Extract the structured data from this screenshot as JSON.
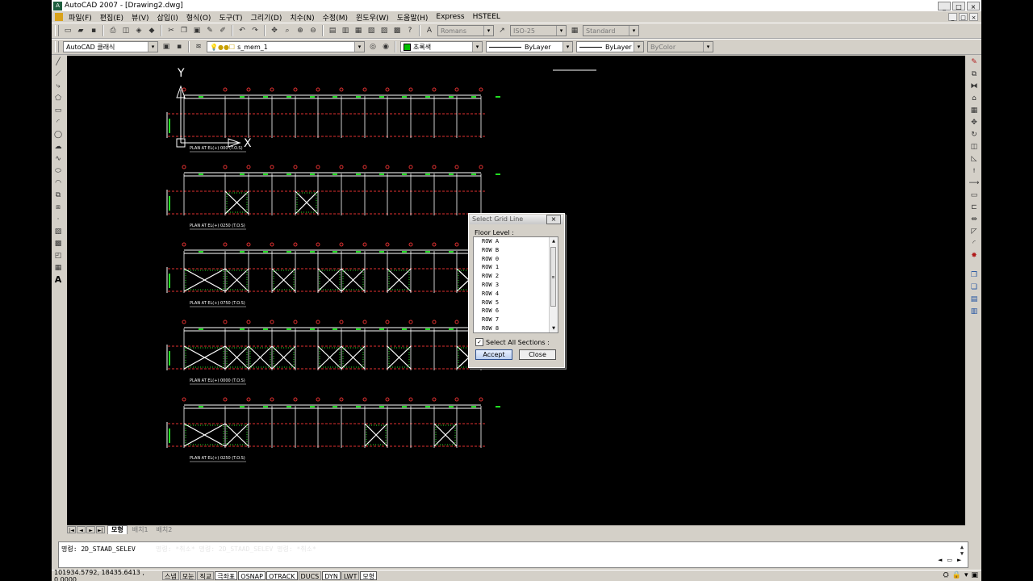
{
  "window": {
    "title": "AutoCAD 2007 - [Drawing2.dwg]",
    "app_icon": "A",
    "minimize": "_",
    "maximize": "□",
    "close": "×"
  },
  "menu": {
    "items": [
      "파일(F)",
      "편집(E)",
      "뷰(V)",
      "삽입(I)",
      "형식(O)",
      "도구(T)",
      "그리기(D)",
      "치수(N)",
      "수정(M)",
      "윈도우(W)",
      "도움말(H)",
      "Express",
      "HSTEEL"
    ]
  },
  "toolbar1": {
    "text_style": "Romans",
    "dim_style": "ISO-25",
    "table_style": "Standard"
  },
  "toolbar2": {
    "workspace": "AutoCAD 클래식",
    "layer": "s_mem_1",
    "color": "초록색",
    "linetype": "ByLayer",
    "lineweight": "ByLayer",
    "plotstyle": "ByColor"
  },
  "tabs": {
    "nav": [
      "|◄",
      "◄",
      "►",
      "►|"
    ],
    "model": "모형",
    "layout1": "배치1",
    "layout2": "배치2"
  },
  "command": {
    "prompt": "명령: 2D_STAAD_SELEV",
    "history_ghost": "명령:  *취소*     명령:  2D_STAAD_SELEV     명령:  *취소*"
  },
  "status": {
    "coords": "101934.5792, 18435.6413 , 0.0000",
    "buttons": [
      {
        "label": "스냅",
        "on": false
      },
      {
        "label": "모눈",
        "on": false
      },
      {
        "label": "직교",
        "on": false
      },
      {
        "label": "극좌표",
        "on": true
      },
      {
        "label": "OSNAP",
        "on": true
      },
      {
        "label": "OTRACK",
        "on": true
      },
      {
        "label": "DUCS",
        "on": false
      },
      {
        "label": "DYN",
        "on": true
      },
      {
        "label": "LWT",
        "on": false
      },
      {
        "label": "모형",
        "on": true
      }
    ]
  },
  "drawing": {
    "ucs_y": "Y",
    "ucs_x": "X",
    "plans": [
      {
        "label": "PLAN AT EL(+) 000 (T.O.S)"
      },
      {
        "label": "PLAN AT EL(+) 0250 (T.O.S)"
      },
      {
        "label": "PLAN AT EL(+) 0750 (T.O.S)"
      },
      {
        "label": "PLAN AT EL(+) 0000 (T.O.S)"
      },
      {
        "label": "PLAN AT EL(+) 0250 (T.O.S)"
      }
    ],
    "colors": {
      "red": "#e03030",
      "white": "#ffffff",
      "green": "#22dd22"
    }
  },
  "dialog": {
    "title": "Select Grid Line",
    "close": "×",
    "floor_label": "Floor Level :",
    "rows": [
      "ROW A",
      "ROW B",
      "ROW 0",
      "ROW 1",
      "ROW 2",
      "ROW 3",
      "ROW 4",
      "ROW 5",
      "ROW 6",
      "ROW 7",
      "ROW 8"
    ],
    "select_all_label": "Select All Sections :",
    "select_all_checked": true,
    "accept": "Accept",
    "close_button": "Close"
  }
}
